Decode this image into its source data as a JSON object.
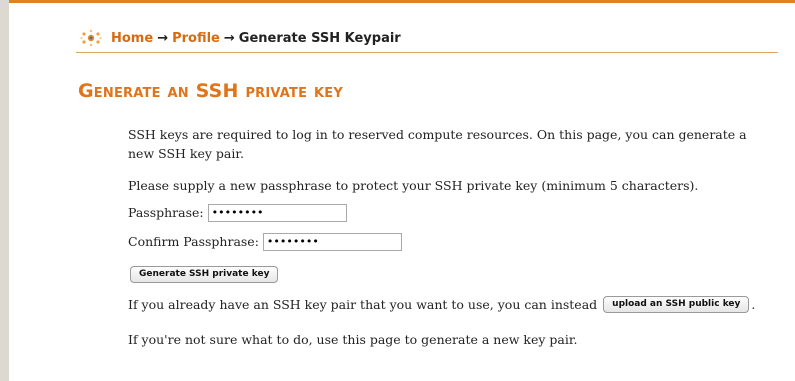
{
  "breadcrumb": {
    "home": "Home",
    "arrow1": "→",
    "profile": "Profile",
    "arrow2": "→",
    "current": "Generate SSH Keypair"
  },
  "page": {
    "title": "Generate an SSH private key"
  },
  "content": {
    "intro": "SSH keys are required to log in to reserved compute resources. On this page, you can generate a new SSH key pair.",
    "instruction": "Please supply a new passphrase to protect your SSH private key (minimum 5 characters).",
    "passphrase_label": "Passphrase:",
    "passphrase_value": "••••••••",
    "confirm_label": "Confirm Passphrase:",
    "confirm_value": "••••••••",
    "generate_button": "Generate SSH private key",
    "upload_text": "If you already have an SSH key pair that you want to use, you can instead",
    "upload_button": "upload an SSH public key",
    "upload_suffix": ".",
    "last_text": "If you're not sure what to do, use this page to generate a new key pair."
  },
  "colors": {
    "accent": "#e0741a",
    "link": "#d86b10",
    "top_line": "#e4801e",
    "left_bar": "#dcdad0"
  }
}
